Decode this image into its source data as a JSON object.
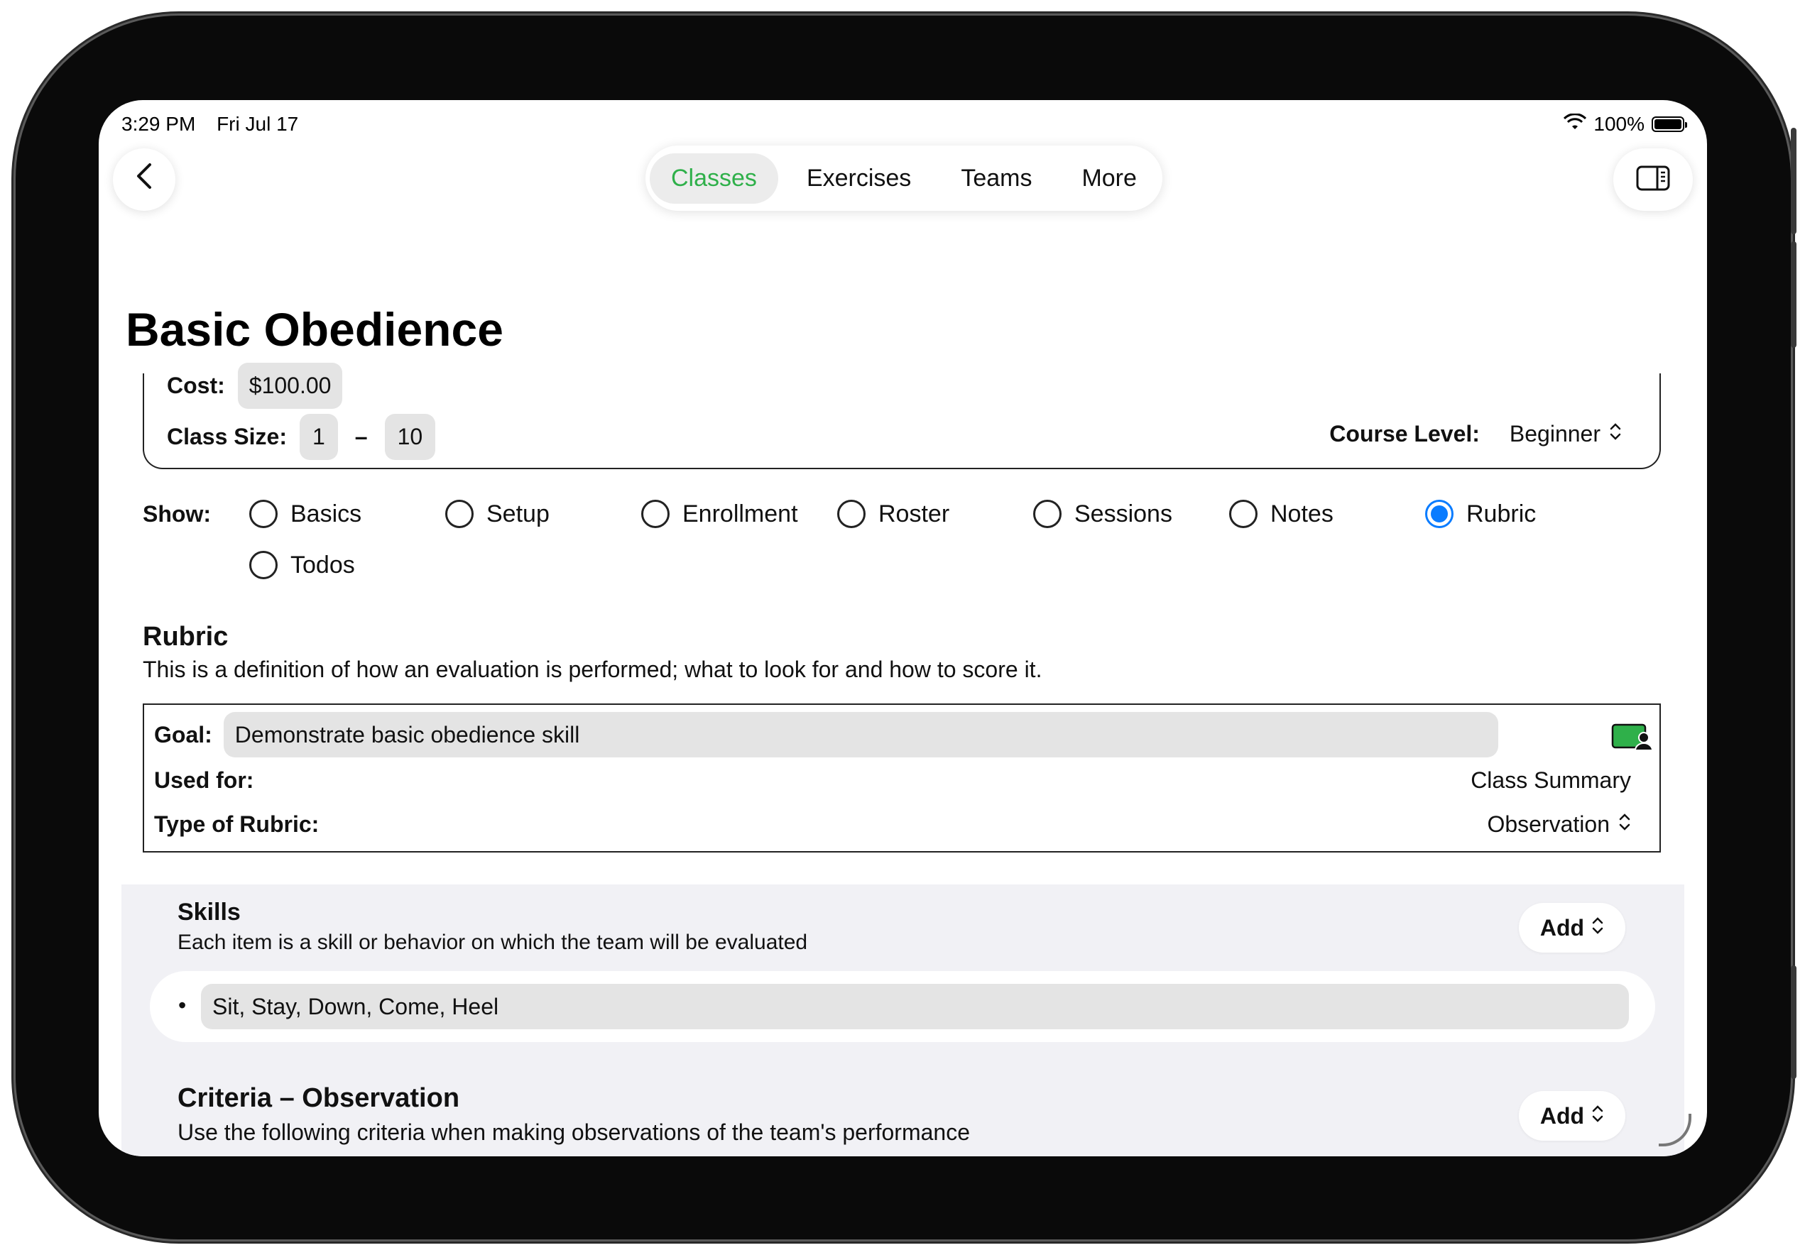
{
  "status": {
    "time": "3:29 PM",
    "date": "Fri Jul 17",
    "battery": "100%"
  },
  "nav": {
    "tabs": [
      {
        "label": "Classes",
        "active": true
      },
      {
        "label": "Exercises",
        "active": false
      },
      {
        "label": "Teams",
        "active": false
      },
      {
        "label": "More",
        "active": false
      }
    ]
  },
  "page": {
    "title": "Basic Obedience"
  },
  "basics": {
    "cost_label": "Cost:",
    "cost_value": "$100.00",
    "class_size_label": "Class Size:",
    "class_size_min": "1",
    "class_size_dash": "–",
    "class_size_max": "10",
    "course_level_label": "Course Level:",
    "course_level_value": "Beginner"
  },
  "show": {
    "label": "Show:",
    "options": [
      {
        "label": "Basics",
        "selected": false
      },
      {
        "label": "Setup",
        "selected": false
      },
      {
        "label": "Enrollment",
        "selected": false
      },
      {
        "label": "Roster",
        "selected": false
      },
      {
        "label": "Sessions",
        "selected": false
      },
      {
        "label": "Notes",
        "selected": false
      },
      {
        "label": "Rubric",
        "selected": true
      },
      {
        "label": "Todos",
        "selected": false
      }
    ]
  },
  "rubric": {
    "heading": "Rubric",
    "description": "This is a definition of how an evaluation is performed; what to look for and how to score it.",
    "goal_label": "Goal:",
    "goal_value": "Demonstrate basic obedience skill",
    "used_for_label": "Used for:",
    "used_for_value": "Class Summary",
    "type_label": "Type of Rubric:",
    "type_value": "Observation"
  },
  "skills": {
    "heading": "Skills",
    "description": "Each item is a skill or behavior on which the team will be evaluated",
    "add_label": "Add",
    "items": [
      "Sit, Stay, Down, Come, Heel"
    ]
  },
  "criteria": {
    "heading": "Criteria – Observation",
    "description": "Use the following criteria when making observations of the team's performance",
    "add_label": "Add"
  },
  "colors": {
    "accent_green": "#2fb04a",
    "radio_blue": "#0a7cff",
    "panel_bg": "#f1f1f5"
  }
}
